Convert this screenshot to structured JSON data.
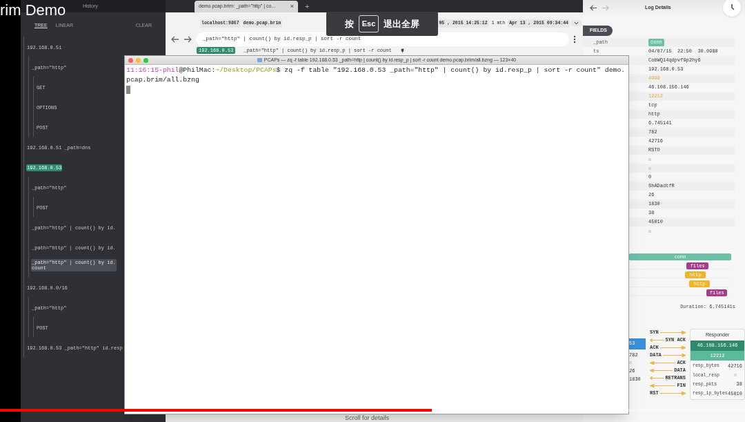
{
  "video_title": "rim Demo",
  "sidebar": {
    "header_tab": "History",
    "modes": [
      {
        "label": "TREE",
        "selected": true
      },
      {
        "label": "LINEAR",
        "selected": false
      }
    ],
    "clear": "CLEAR",
    "tree": [
      {
        "label": "192.168.0.51",
        "pinned": false,
        "selected": false,
        "children": [
          {
            "label": "_path=\"http\"",
            "pinned": false,
            "selected": false,
            "children": [
              {
                "label": "GET",
                "pinned": false,
                "selected": false
              },
              {
                "label": "OPTIONS",
                "pinned": false,
                "selected": false
              },
              {
                "label": "POST",
                "pinned": false,
                "selected": false
              }
            ]
          }
        ]
      },
      {
        "label": "192.168.0.51 _path=dns",
        "pinned": false,
        "selected": false
      },
      {
        "label": "192.168.0.53",
        "pinned": true,
        "selected": false,
        "children": [
          {
            "label": "_path=\"http\"",
            "pinned": false,
            "selected": false,
            "children": [
              {
                "label": "POST",
                "pinned": false,
                "selected": false
              }
            ]
          },
          {
            "label": "_path=\"http\" | count() by id.",
            "pinned": false,
            "selected": false
          },
          {
            "label": "_path=\"http\" | count() by id.",
            "pinned": false,
            "selected": false
          },
          {
            "label": "_path=\"http\" | count() by id.",
            "continuation": "count",
            "pinned": false,
            "selected": true
          }
        ]
      },
      {
        "label": "192.168.0.0/16",
        "pinned": false,
        "selected": false,
        "children": [
          {
            "label": "_path=\"http\"",
            "pinned": false,
            "selected": false,
            "children": [
              {
                "label": "POST",
                "pinned": false,
                "selected": false
              }
            ]
          }
        ]
      },
      {
        "label": "192.168.0.53 _path=\"http\" id.resp",
        "pinned": false,
        "selected": false
      }
    ]
  },
  "main": {
    "tab": {
      "label": "demo.pcap.brim: _path=\"http\" | co...",
      "close": "×"
    },
    "new_tab": "+",
    "toolbar": {
      "connection": "localhost:9867",
      "space": "demo.pcap.brim",
      "from": "05 , 2015 14:25:12",
      "span": "1 mth",
      "to": "Apr 13 , 2015 09:34:44"
    },
    "search": "_path=\"http\" | count() by id.resp_p | sort -r count",
    "breadcrumbs": [
      {
        "kind": "pinned",
        "text": "192.168.0.53"
      },
      {
        "kind": "query",
        "text": "_path=\"http\" | count() by id.resp_p | sort -r count"
      }
    ]
  },
  "fullscreen_toast": {
    "before": "按",
    "key": "Esc",
    "after": "退出全屏"
  },
  "log_details": {
    "title": "Log Details",
    "section": "FIELDS",
    "fields": [
      {
        "name": "_path",
        "kind": "badge",
        "value": "conn"
      },
      {
        "name": "ts",
        "kind": "text",
        "value": "04/07/15  22:50  30.0980"
      },
      {
        "kind": "text",
        "value": "CobWQ14qdpvf9p2hy6"
      },
      {
        "kind": "text",
        "value": "192.168.0.53"
      },
      {
        "kind": "port",
        "value": "4999"
      },
      {
        "kind": "text",
        "value": "46.108.156.146"
      },
      {
        "kind": "port",
        "value": "12212"
      },
      {
        "kind": "text",
        "value": "tcp"
      },
      {
        "kind": "text",
        "value": "http"
      },
      {
        "kind": "text",
        "value": "6.745141"
      },
      {
        "kind": "text",
        "value": "782"
      },
      {
        "kind": "text",
        "value": "42716"
      },
      {
        "kind": "text",
        "value": "RSTO"
      },
      {
        "kind": "unset"
      },
      {
        "kind": "unset"
      },
      {
        "kind": "text",
        "value": "0"
      },
      {
        "kind": "text",
        "value": "ShADadtfR"
      },
      {
        "kind": "text",
        "value": "26"
      },
      {
        "kind": "text",
        "value": "1830"
      },
      {
        "kind": "text",
        "value": "38"
      },
      {
        "kind": "text",
        "value": "45010"
      },
      {
        "kind": "unset"
      }
    ],
    "timeline": [
      {
        "label": "conn",
        "color": "#6dbfa8"
      },
      {
        "label": "files",
        "color": "#a63d8c"
      },
      {
        "label": "http",
        "color": "#f0b429"
      },
      {
        "label": "http",
        "color": "#f0b429"
      },
      {
        "label": "files",
        "color": "#a63d8c"
      }
    ],
    "duration": "Duration: 6.745141s",
    "originator_partial": [
      {
        "kind": "address",
        "value": "53"
      },
      {
        "kind": "text",
        "value": "782"
      },
      {
        "kind": "unset"
      },
      {
        "kind": "text",
        "value": "26"
      },
      {
        "kind": "text",
        "value": "1830"
      }
    ],
    "history": [
      {
        "label": "SYN",
        "leftward": false
      },
      {
        "label": "SYN ACK",
        "leftward": true
      },
      {
        "label": "ACK",
        "leftward": false
      },
      {
        "label": "DATA",
        "leftward": false
      },
      {
        "label": "ACK",
        "leftward": true
      },
      {
        "label": "DATA",
        "leftward": true
      },
      {
        "label": "RETRANS",
        "leftward": true
      },
      {
        "label": "FIN",
        "leftward": true
      },
      {
        "label": "RST",
        "leftward": false
      }
    ],
    "responder": {
      "title": "Responder",
      "address": "46.108.156.146",
      "port": "12212",
      "stats": [
        {
          "name": "resp_bytes",
          "value": "42716"
        },
        {
          "name": "local_resp"
        },
        {
          "name": "resp_pkts",
          "value": "38"
        },
        {
          "name": "resp_ip_bytes",
          "value": "45010"
        }
      ]
    }
  },
  "terminal": {
    "title": "PCAPs — zq -f table 192.168.0.53 _path=http | count() by id.resp_p | sort -r count demo.pcap.brim/all.bzng — 123×40",
    "segments": [
      {
        "text": "11:16:15-phil",
        "kind": "user"
      },
      {
        "text": "@PhilMac:",
        "kind": "plain"
      },
      {
        "text": "~/Desktop/PCAPs",
        "kind": "path"
      },
      {
        "text": "$ zq -f table \"192.168.0.53 _path=\"http\" | count() by id.resp_p | sort -r count\" demo.pcap.brim/all.bzng",
        "kind": "plain"
      }
    ]
  },
  "video": {
    "level": 0.58,
    "hint": "Scroll for details"
  }
}
